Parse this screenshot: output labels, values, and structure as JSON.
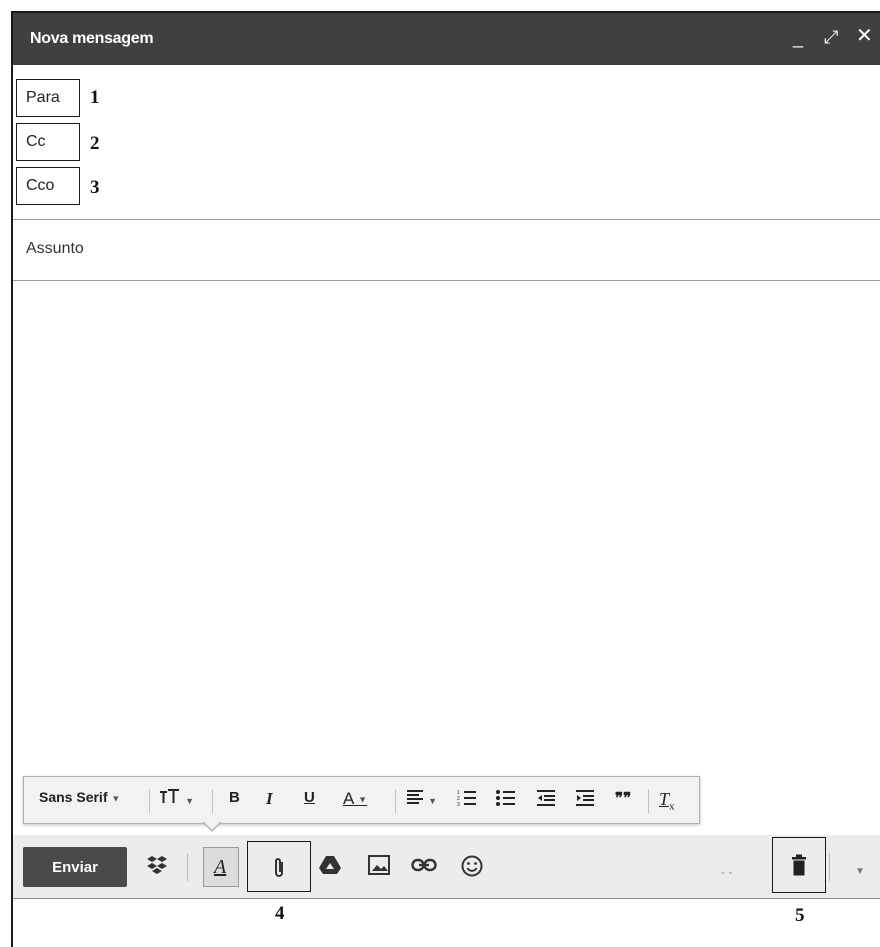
{
  "window": {
    "title": "Nova mensagem",
    "controls": {
      "minimize": "_",
      "expand": "⤢",
      "close": "✕"
    }
  },
  "fields": [
    {
      "label": "Para",
      "number": "1"
    },
    {
      "label": "Cc",
      "number": "2"
    },
    {
      "label": "Cco",
      "number": "3"
    }
  ],
  "subject": {
    "placeholder": "Assunto"
  },
  "format_toolbar": {
    "font": "Sans Serif",
    "size_icon": "text-size-icon",
    "bold": "B",
    "italic": "I",
    "underline": "U",
    "text_color": "A",
    "align_icon": "align-icon",
    "numbered_list_icon": "numbered-list-icon",
    "bulleted_list_icon": "bulleted-list-icon",
    "indent_less_icon": "indent-less-icon",
    "indent_more_icon": "indent-more-icon",
    "quote": "❞❞",
    "clear_format": "T"
  },
  "bottom_toolbar": {
    "send_label": "Enviar",
    "icons": [
      "dropbox-icon",
      "formatting-icon",
      "attach-icon",
      "drive-icon",
      "photo-icon",
      "link-icon",
      "emoji-icon",
      "trash-icon",
      "more-options-icon"
    ],
    "attach_number": "4",
    "trash_number": "5"
  },
  "colors": {
    "titlebar": "#404040",
    "send_button": "#4a4a4a",
    "toolbar_bg": "#ececec"
  }
}
